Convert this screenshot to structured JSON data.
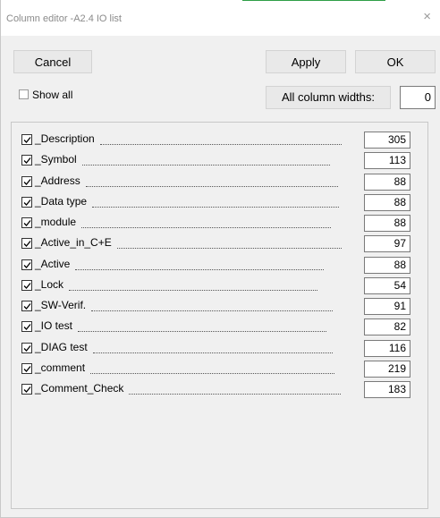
{
  "window": {
    "title": "Column editor -A2.4 IO list",
    "close_glyph": "×"
  },
  "toolbar": {
    "cancel_label": "Cancel",
    "apply_label": "Apply",
    "ok_label": "OK"
  },
  "options": {
    "show_all_label": "Show all",
    "show_all_checked": false,
    "all_widths_label": "All column widths:",
    "all_widths_value": "0"
  },
  "columns": [
    {
      "label": "_Description",
      "checked": true,
      "width": "305"
    },
    {
      "label": "_Symbol",
      "checked": true,
      "width": "113"
    },
    {
      "label": "_Address",
      "checked": true,
      "width": "88"
    },
    {
      "label": "_Data type",
      "checked": true,
      "width": "88"
    },
    {
      "label": "_module",
      "checked": true,
      "width": "88"
    },
    {
      "label": "_Active_in_C+E",
      "checked": true,
      "width": "97"
    },
    {
      "label": "_Active",
      "checked": true,
      "width": "88"
    },
    {
      "label": "_Lock",
      "checked": true,
      "width": "54"
    },
    {
      "label": "_SW-Verif.",
      "checked": true,
      "width": "91"
    },
    {
      "label": "_IO test",
      "checked": true,
      "width": "82"
    },
    {
      "label": "_DIAG test",
      "checked": true,
      "width": "116"
    },
    {
      "label": "_comment",
      "checked": true,
      "width": "219"
    },
    {
      "label": "_Comment_Check",
      "checked": true,
      "width": "183"
    }
  ],
  "colors": {
    "accent_line": "#2e9e46",
    "window_bg": "#f0f0f0",
    "button_bg": "#e9e9e9"
  }
}
